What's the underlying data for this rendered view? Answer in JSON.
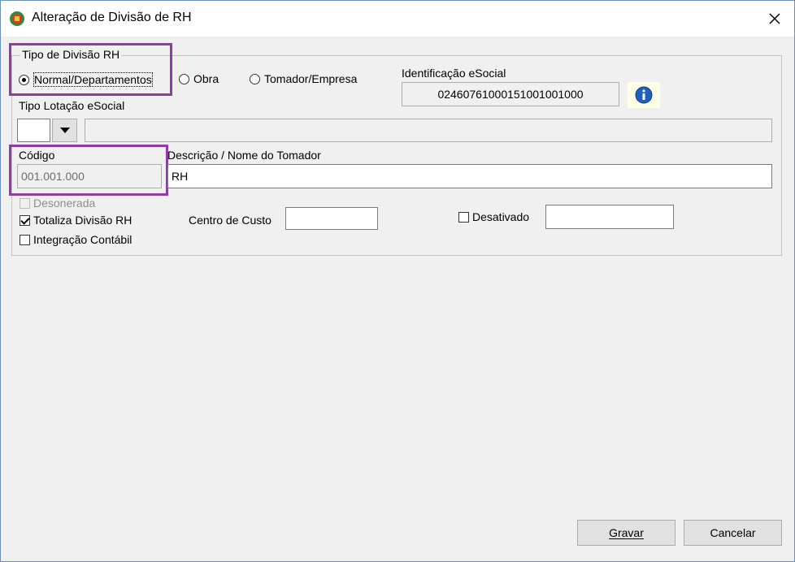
{
  "window": {
    "title": "Alteração de Divisão de RH"
  },
  "group": {
    "legend": "Tipo de Divisão RH",
    "radios": {
      "normal": "Normal/Departamentos",
      "obra": "Obra",
      "tomador": "Tomador/Empresa",
      "selected": "Normal/Departamentos"
    }
  },
  "esocial": {
    "label": "Identificação eSocial",
    "value": "02460761000151001001000"
  },
  "lotacao": {
    "label": "Tipo Lotação eSocial",
    "value": "",
    "description": ""
  },
  "codigo": {
    "label": "Código",
    "value": "001.001.000"
  },
  "descricao": {
    "label": "Descrição / Nome do Tomador",
    "value": "RH"
  },
  "checks": {
    "desonerada": {
      "label": "Desonerada",
      "checked": false,
      "enabled": false
    },
    "totaliza": {
      "label": "Totaliza Divisão RH",
      "checked": true
    },
    "integracao": {
      "label": "Integração Contábil",
      "checked": false
    },
    "desativado": {
      "label": "Desativado",
      "checked": false
    }
  },
  "centro_custo": {
    "label": "Centro de Custo",
    "value": ""
  },
  "desativado_field": {
    "value": ""
  },
  "buttons": {
    "gravar": "Gravar",
    "cancelar": "Cancelar"
  },
  "colors": {
    "highlight": "#8e3ea3",
    "info": "#1f5fbf"
  }
}
